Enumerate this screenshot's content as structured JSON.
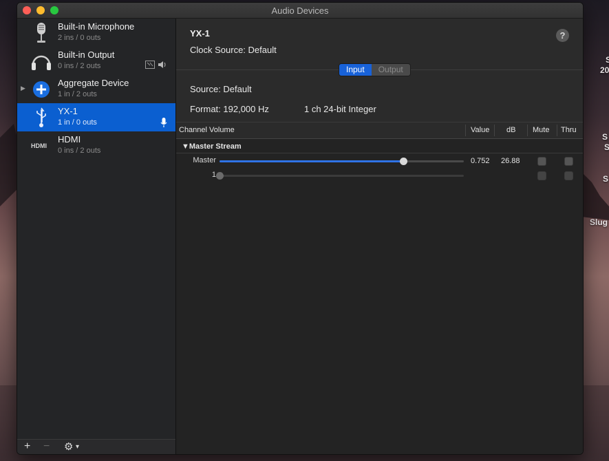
{
  "window": {
    "title": "Audio Devices"
  },
  "desktop_labels": [
    "S",
    "20",
    "S",
    "S",
    "S",
    "Slug"
  ],
  "devices": [
    {
      "name": "Built-in Microphone",
      "sub": "2 ins / 0 outs",
      "icon": "microphone-icon"
    },
    {
      "name": "Built-in Output",
      "sub": "0 ins / 2 outs",
      "icon": "headphones-icon"
    },
    {
      "name": "Aggregate Device",
      "sub": "1 in / 2 outs",
      "icon": "aggregate-plus-icon"
    },
    {
      "name": "YX-1",
      "sub": "1 in / 0 outs",
      "icon": "usb-icon",
      "selected": true
    },
    {
      "name": "HDMI",
      "sub": "0 ins / 2 outs",
      "icon": "hdmi-icon",
      "icon_text": "HDMI"
    }
  ],
  "sidebar_bottom": {
    "add": "+",
    "remove": "−",
    "gear": "⚙",
    "chevron": "▾"
  },
  "detail": {
    "title": "YX-1",
    "clock_source": "Clock Source:  Default",
    "help": "?",
    "tabs": [
      {
        "label": "Input",
        "active": true
      },
      {
        "label": "Output",
        "active": false
      }
    ],
    "source": "Source:  Default",
    "format_label": "Format:  192,000 Hz",
    "format_detail": "1 ch 24-bit Integer"
  },
  "table": {
    "headers": {
      "channel": "Channel Volume",
      "value": "Value",
      "db": "dB",
      "mute": "Mute",
      "thru": "Thru"
    },
    "group": "▼Master Stream",
    "rows": [
      {
        "label": "Master",
        "value": "0.752",
        "db": "26.88",
        "level": 0.752,
        "enabled": true
      },
      {
        "label": "1",
        "value": "",
        "db": "",
        "level": 0.0,
        "enabled": false
      }
    ]
  },
  "colors": {
    "accent": "#1862d9",
    "selection": "#0b5fd0"
  }
}
